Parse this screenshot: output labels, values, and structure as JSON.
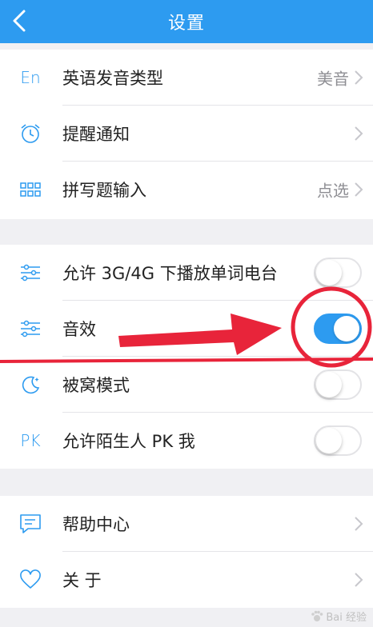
{
  "nav": {
    "title": "设置"
  },
  "group1": [
    {
      "icon": "language-icon",
      "icon_text": "En",
      "label": "英语发音类型",
      "value": "美音"
    },
    {
      "icon": "alarm-clock-icon",
      "label": "提醒通知",
      "value": ""
    },
    {
      "icon": "grid-icon",
      "label": "拼写题输入",
      "value": "点选"
    }
  ],
  "group2": [
    {
      "icon": "sliders-icon",
      "label": "允许 3G/4G 下播放单词电台",
      "toggle": false
    },
    {
      "icon": "sliders-icon",
      "label": "音效",
      "toggle": true
    },
    {
      "icon": "moon-icon",
      "label": "被窝模式",
      "toggle": false
    },
    {
      "icon": "pk-icon",
      "icon_text": "PK",
      "label": "允许陌生人 PK 我",
      "toggle": false
    }
  ],
  "group3": [
    {
      "icon": "help-message-icon",
      "label": "帮助中心"
    },
    {
      "icon": "heart-icon",
      "label": "关 于"
    }
  ],
  "watermark": {
    "text": "Bai 经验"
  },
  "colors": {
    "accent": "#2d9bf0",
    "annotation": "#e8243a"
  }
}
